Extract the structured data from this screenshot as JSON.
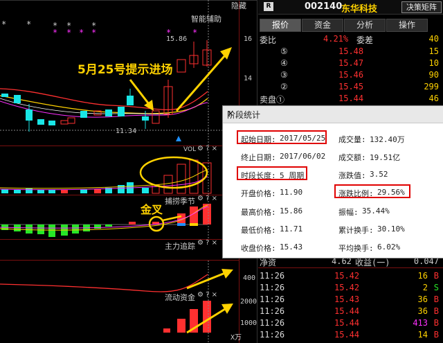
{
  "chart": {
    "hide_label": "隐藏",
    "assist_label": "智能辅助",
    "price_high_label": "15.86",
    "price_low_label": "11.34",
    "axis_main": [
      "16",
      "14"
    ],
    "annotation_text": "5月25号提示进场",
    "golden_cross_text": "金叉",
    "indicators": {
      "vol": "VOL",
      "catch": "捕捞季节",
      "main_track": "主力追踪",
      "flow": "流动资金"
    },
    "axis_flow": [
      "400",
      "2000",
      "1000"
    ],
    "x_unit": "X万",
    "toolbar_icons": "⚙ ? ×"
  },
  "header": {
    "badge": "R",
    "code": "002140",
    "name": "东华科技",
    "matrix_button": "决策矩阵"
  },
  "tabs": [
    "报价",
    "资金",
    "分析",
    "操作"
  ],
  "quote": {
    "ratio_label": "委比",
    "ratio_value": "4.21%",
    "diff_label": "委差",
    "diff_value": "40",
    "levels": [
      {
        "label": "⑤",
        "price": "15.48",
        "vol": "15"
      },
      {
        "label": "④",
        "price": "15.47",
        "vol": "10"
      },
      {
        "label": "③",
        "price": "15.46",
        "vol": "90"
      },
      {
        "label": "②",
        "price": "15.45",
        "vol": "299"
      },
      {
        "label": "卖盘①",
        "price": "15.44",
        "vol": "46"
      }
    ],
    "partial_row": {
      "label": "净资",
      "v1": "4.62",
      "label2": "收益(一)",
      "v2": "0.047"
    }
  },
  "stats": {
    "title": "阶段统计",
    "start_date_label": "起始日期:",
    "start_date": "2017/05/25",
    "volume_label": "成交量:",
    "volume": "132.40万",
    "end_date_label": "终止日期:",
    "end_date": "2017/06/02",
    "amount_label": "成交额:",
    "amount": "19.51亿",
    "period_label": "时段长度:",
    "period": "5 周期",
    "change_label": "涨跌值:",
    "change": "3.52",
    "open_label": "开盘价格:",
    "open": "11.90",
    "change_pct_label": "涨跌比例:",
    "change_pct": "29.56%",
    "high_label": "最高价格:",
    "high": "15.86",
    "amplitude_label": "振幅:",
    "amplitude": "35.44%",
    "low_label": "最低价格:",
    "low": "11.71",
    "turnover_label": "累计换手:",
    "turnover": "30.10%",
    "close_label": "收盘价格:",
    "close": "15.43",
    "avg_turnover_label": "平均换手:",
    "avg_turnover": "6.02%"
  },
  "ticks": [
    {
      "time": "11:26",
      "price": "15.42",
      "vol": "16",
      "side": "B"
    },
    {
      "time": "11:26",
      "price": "15.42",
      "vol": "2",
      "side": "S"
    },
    {
      "time": "11:26",
      "price": "15.43",
      "vol": "36",
      "side": "B"
    },
    {
      "time": "11:26",
      "price": "15.44",
      "vol": "36",
      "side": "B"
    },
    {
      "time": "11:26",
      "price": "15.44",
      "vol": "413",
      "side": "B"
    },
    {
      "time": "11:26",
      "price": "15.44",
      "vol": "14",
      "side": "B"
    }
  ],
  "colors": {
    "up": "#ff3030",
    "down": "#19e6e6",
    "yellow": "#ffd200",
    "magenta": "#ff30ff",
    "green_bar": "#27e627"
  }
}
